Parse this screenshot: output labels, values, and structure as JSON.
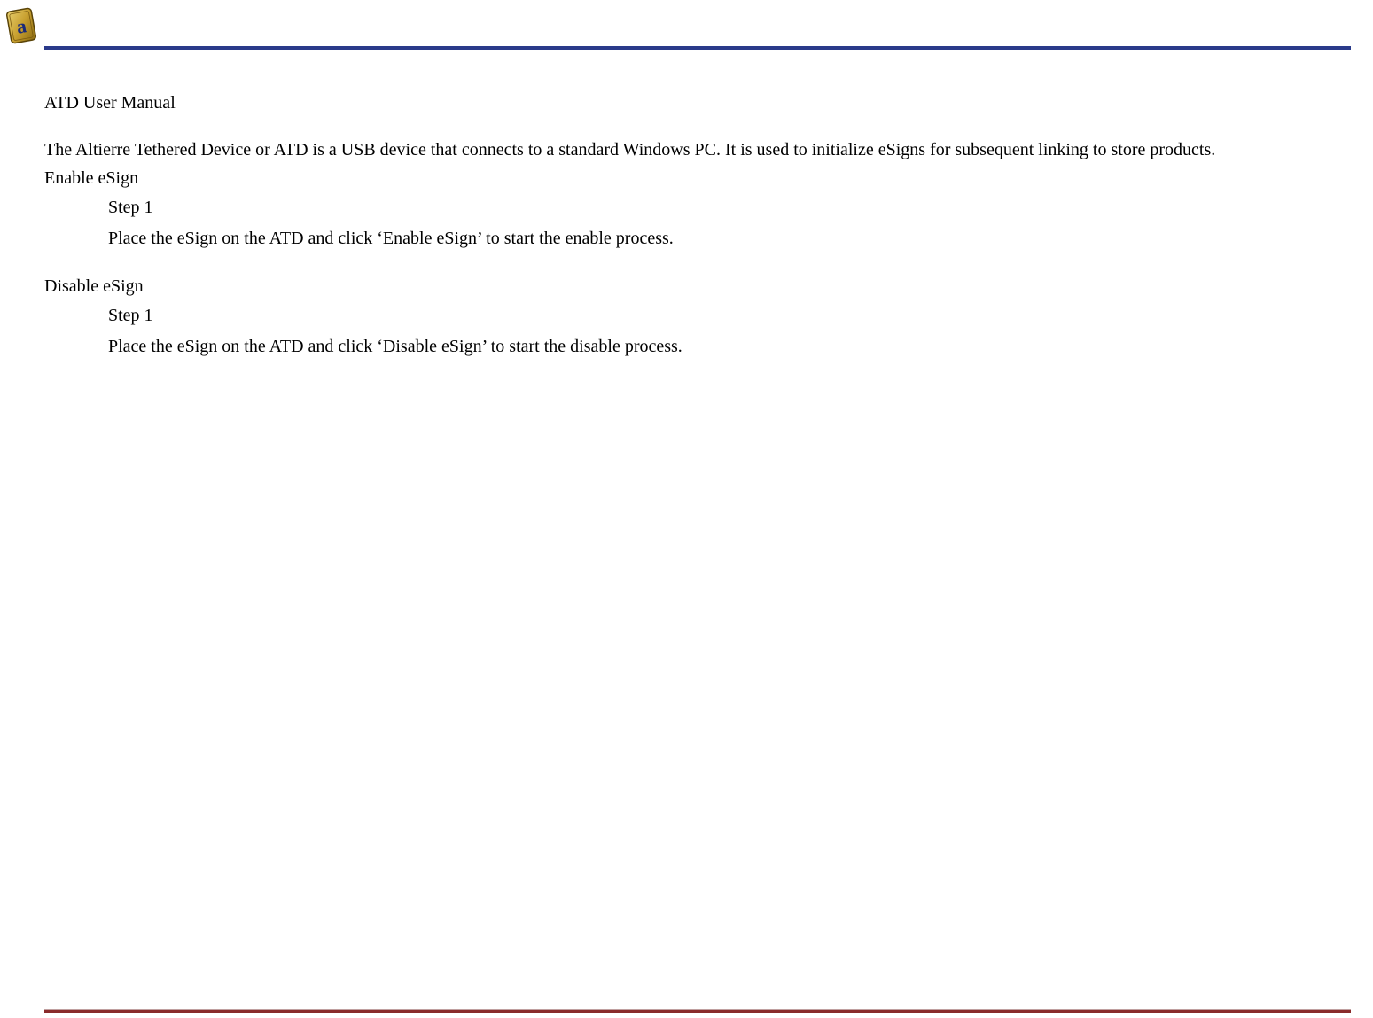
{
  "logo": {
    "name": "altierre-logo-icon",
    "letter": "a"
  },
  "document": {
    "title": "ATD User Manual",
    "intro": "The Altierre Tethered Device or ATD is a USB device that connects to a standard Windows PC. It is used to initialize eSigns for subsequent linking to store products.",
    "sections": [
      {
        "heading": "Enable eSign",
        "step_label": "Step 1",
        "step_text": "Place the eSign on the ATD and click ‘Enable eSign’ to start the enable process."
      },
      {
        "heading": "Disable eSign",
        "step_label": "Step 1",
        "step_text": "Place the eSign on the ATD and click ‘Disable eSign’ to start the disable process."
      }
    ]
  },
  "colors": {
    "header_rule": "#2a3a8a",
    "footer_rule": "#8a2a2a"
  }
}
